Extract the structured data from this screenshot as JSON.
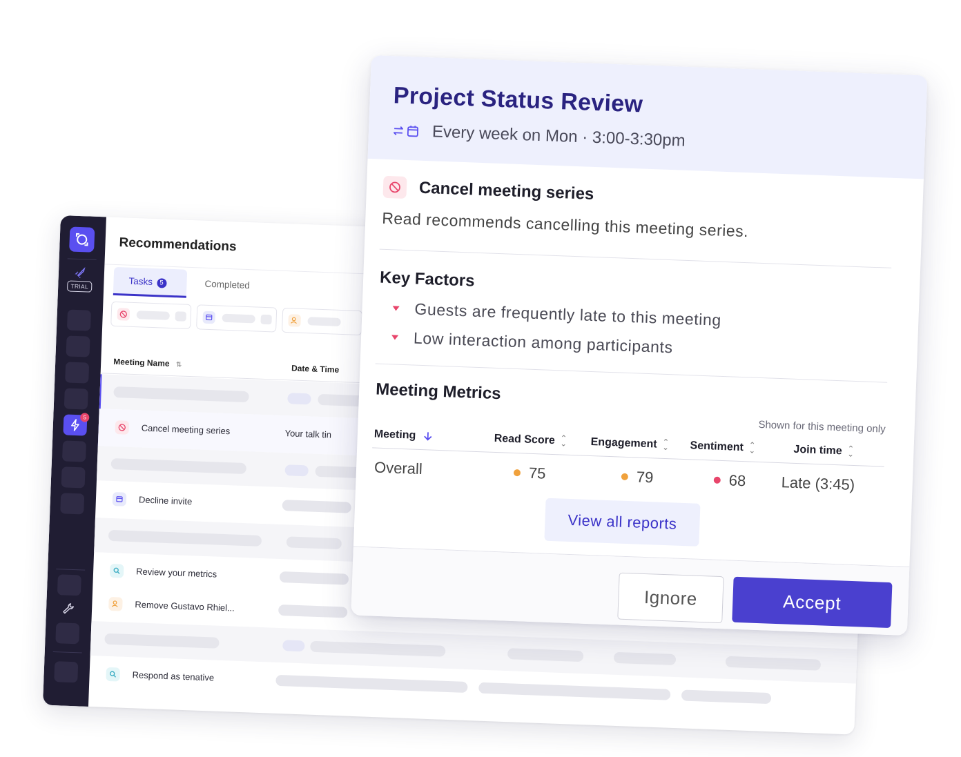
{
  "sidebar": {
    "trial_label": "TRIAL",
    "notification_count": "5"
  },
  "recommendations": {
    "title": "Recommendations",
    "tabs": [
      {
        "label": "Tasks",
        "count": "5"
      },
      {
        "label": "Completed"
      }
    ],
    "columns": [
      "Meeting Name",
      "Date & Time"
    ],
    "rows": [
      {
        "label": "Cancel meeting series",
        "date": "Your talk tin",
        "icon": "cancel-icon"
      },
      {
        "label": "Decline invite",
        "icon": "calendar-icon"
      },
      {
        "label": "Review your metrics",
        "icon": "search-icon"
      },
      {
        "label": "Remove Gustavo Rhiel...",
        "icon": "user-icon"
      },
      {
        "label": "Respond as tenative",
        "icon": "search-icon"
      }
    ]
  },
  "detail": {
    "title": "Project Status Review",
    "schedule": "Every week on Mon · 3:00-3:30pm",
    "action_title": "Cancel meeting series",
    "action_description": "Read recommends cancelling this meeting series.",
    "key_factors_title": "Key Factors",
    "key_factors": [
      "Guests are frequently late to this meeting",
      "Low interaction among participants"
    ],
    "metrics_title": "Meeting Metrics",
    "metrics_note": "Shown for this meeting only",
    "metrics_columns": [
      "Meeting",
      "Read Score",
      "Engagement",
      "Sentiment",
      "Join time"
    ],
    "metrics_row": {
      "meeting": "Overall",
      "read_score": "75",
      "engagement": "79",
      "sentiment": "68",
      "join_time": "Late (3:45)"
    },
    "status_colors": {
      "warning": "#f0a13c",
      "negative": "#e8456b"
    },
    "view_all_label": "View all reports",
    "ignore_label": "Ignore",
    "accept_label": "Accept"
  },
  "colors": {
    "accent": "#4a40cf",
    "header_bg": "#eef0fd",
    "sidebar_bg": "#201d33"
  }
}
